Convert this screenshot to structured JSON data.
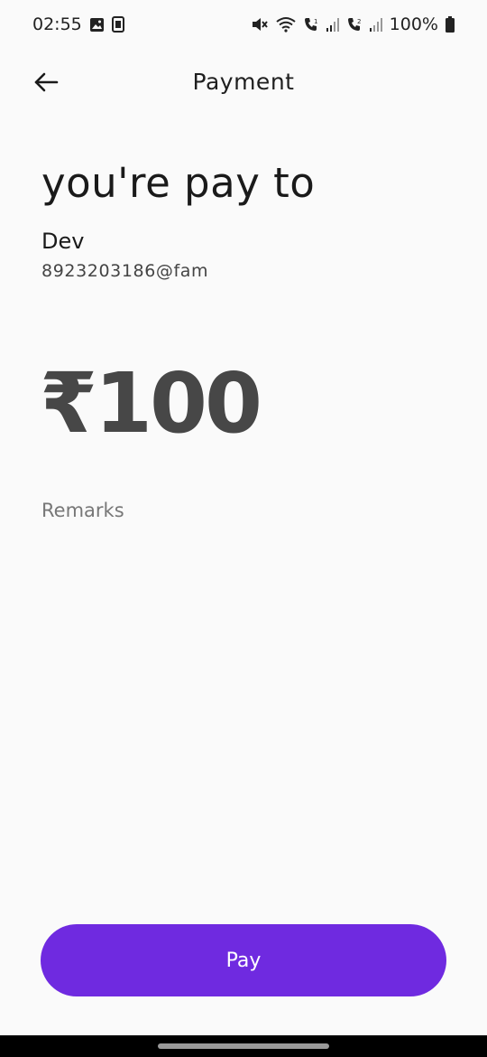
{
  "status_bar": {
    "time": "02:55",
    "battery": "100%",
    "icons": [
      "gallery-icon",
      "sim-icon",
      "mute-icon",
      "wifi-icon",
      "volte1-icon",
      "signal1-icon",
      "volte2-icon",
      "signal2-icon",
      "battery-icon"
    ]
  },
  "header": {
    "title": "Payment",
    "back_icon": "arrow-left-icon"
  },
  "payment": {
    "heading": "you're pay to",
    "payee_name": "Dev",
    "payee_upi": "8923203186@fam",
    "amount": "₹100",
    "remarks_placeholder": "Remarks"
  },
  "actions": {
    "pay_label": "Pay",
    "pay_color": "#6f2ae0"
  }
}
